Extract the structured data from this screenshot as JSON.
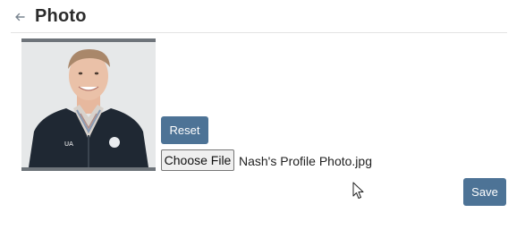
{
  "header": {
    "back_icon": "arrow-left-icon",
    "title": "Photo"
  },
  "photo": {
    "alt": "Profile photo of a smiling man in a dark zip jacket over a plaid collared shirt"
  },
  "actions": {
    "reset_label": "Reset",
    "choose_file_label": "Choose File",
    "file_name": "Nash's Profile Photo.jpg",
    "save_label": "Save"
  },
  "colors": {
    "button_primary": "#4d7396",
    "photo_border": "#6e747a"
  }
}
